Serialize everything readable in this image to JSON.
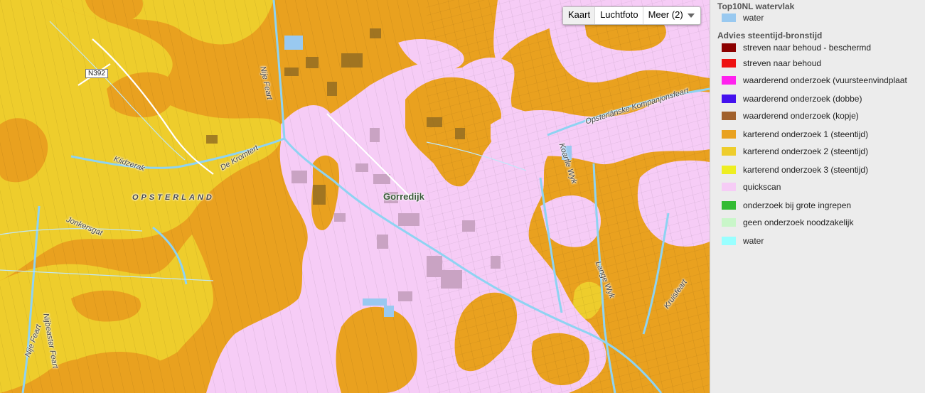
{
  "map": {
    "labels": {
      "road_n392": "N392",
      "canal_nije_feart_north": "Nije Feart",
      "road_kiidzerak": "Kiidzerak",
      "road_de_kromtert": "De Kromtert",
      "region_opsterland": "OPSTERLAND",
      "road_jonkersgat": "Jonkersgat",
      "place_gorredijk": "Gorredijk",
      "canal_opsterlanske_kompanjonsfeart": "Opsterlânske Kompanjonsfeart",
      "road_koartle_wyk": "Koartle Wyk",
      "road_lange_wyk": "Lange Wyk",
      "road_kruisfeart": "Kruisfeart",
      "canal_nije_feart_south": "Nije Feart",
      "road_nijbeaster_feart": "Nijbeaster Feart"
    },
    "map_type_control": {
      "options": [
        "Kaart",
        "Luchtfoto",
        "Meer (2)"
      ],
      "selected": "Kaart",
      "dropdown_icon": "triangle-down-icon"
    }
  },
  "legend": {
    "groups": [
      {
        "title": "Top10NL watervlak",
        "items": [
          {
            "label": "water",
            "color": "#99c9f0"
          }
        ]
      },
      {
        "title": "Advies steentijd-bronstijd",
        "items": [
          {
            "label": "streven naar behoud - beschermd",
            "color": "#8b0000"
          },
          {
            "label": "streven naar behoud",
            "color": "#ee1111"
          },
          {
            "label": "waarderend onderzoek (vuursteenvindplaat",
            "color": "#ff22ee"
          },
          {
            "label": "waarderend onderzoek (dobbe)",
            "color": "#4411ee"
          },
          {
            "label": "waarderend onderzoek (kopje)",
            "color": "#a0602c"
          },
          {
            "label": "karterend onderzoek 1 (steentijd)",
            "color": "#e9a11f"
          },
          {
            "label": "karterend onderzoek 2 (steentijd)",
            "color": "#eecd2c"
          },
          {
            "label": "karterend onderzoek 3 (steentijd)",
            "color": "#eeee22"
          },
          {
            "label": "quickscan",
            "color": "#f6ccf6"
          },
          {
            "label": "onderzoek bij grote ingrepen",
            "color": "#33bb33"
          },
          {
            "label": "geen onderzoek noodzakelijk",
            "color": "#c9f6c9"
          },
          {
            "label": "water",
            "color": "#99ffff"
          }
        ]
      }
    ]
  }
}
